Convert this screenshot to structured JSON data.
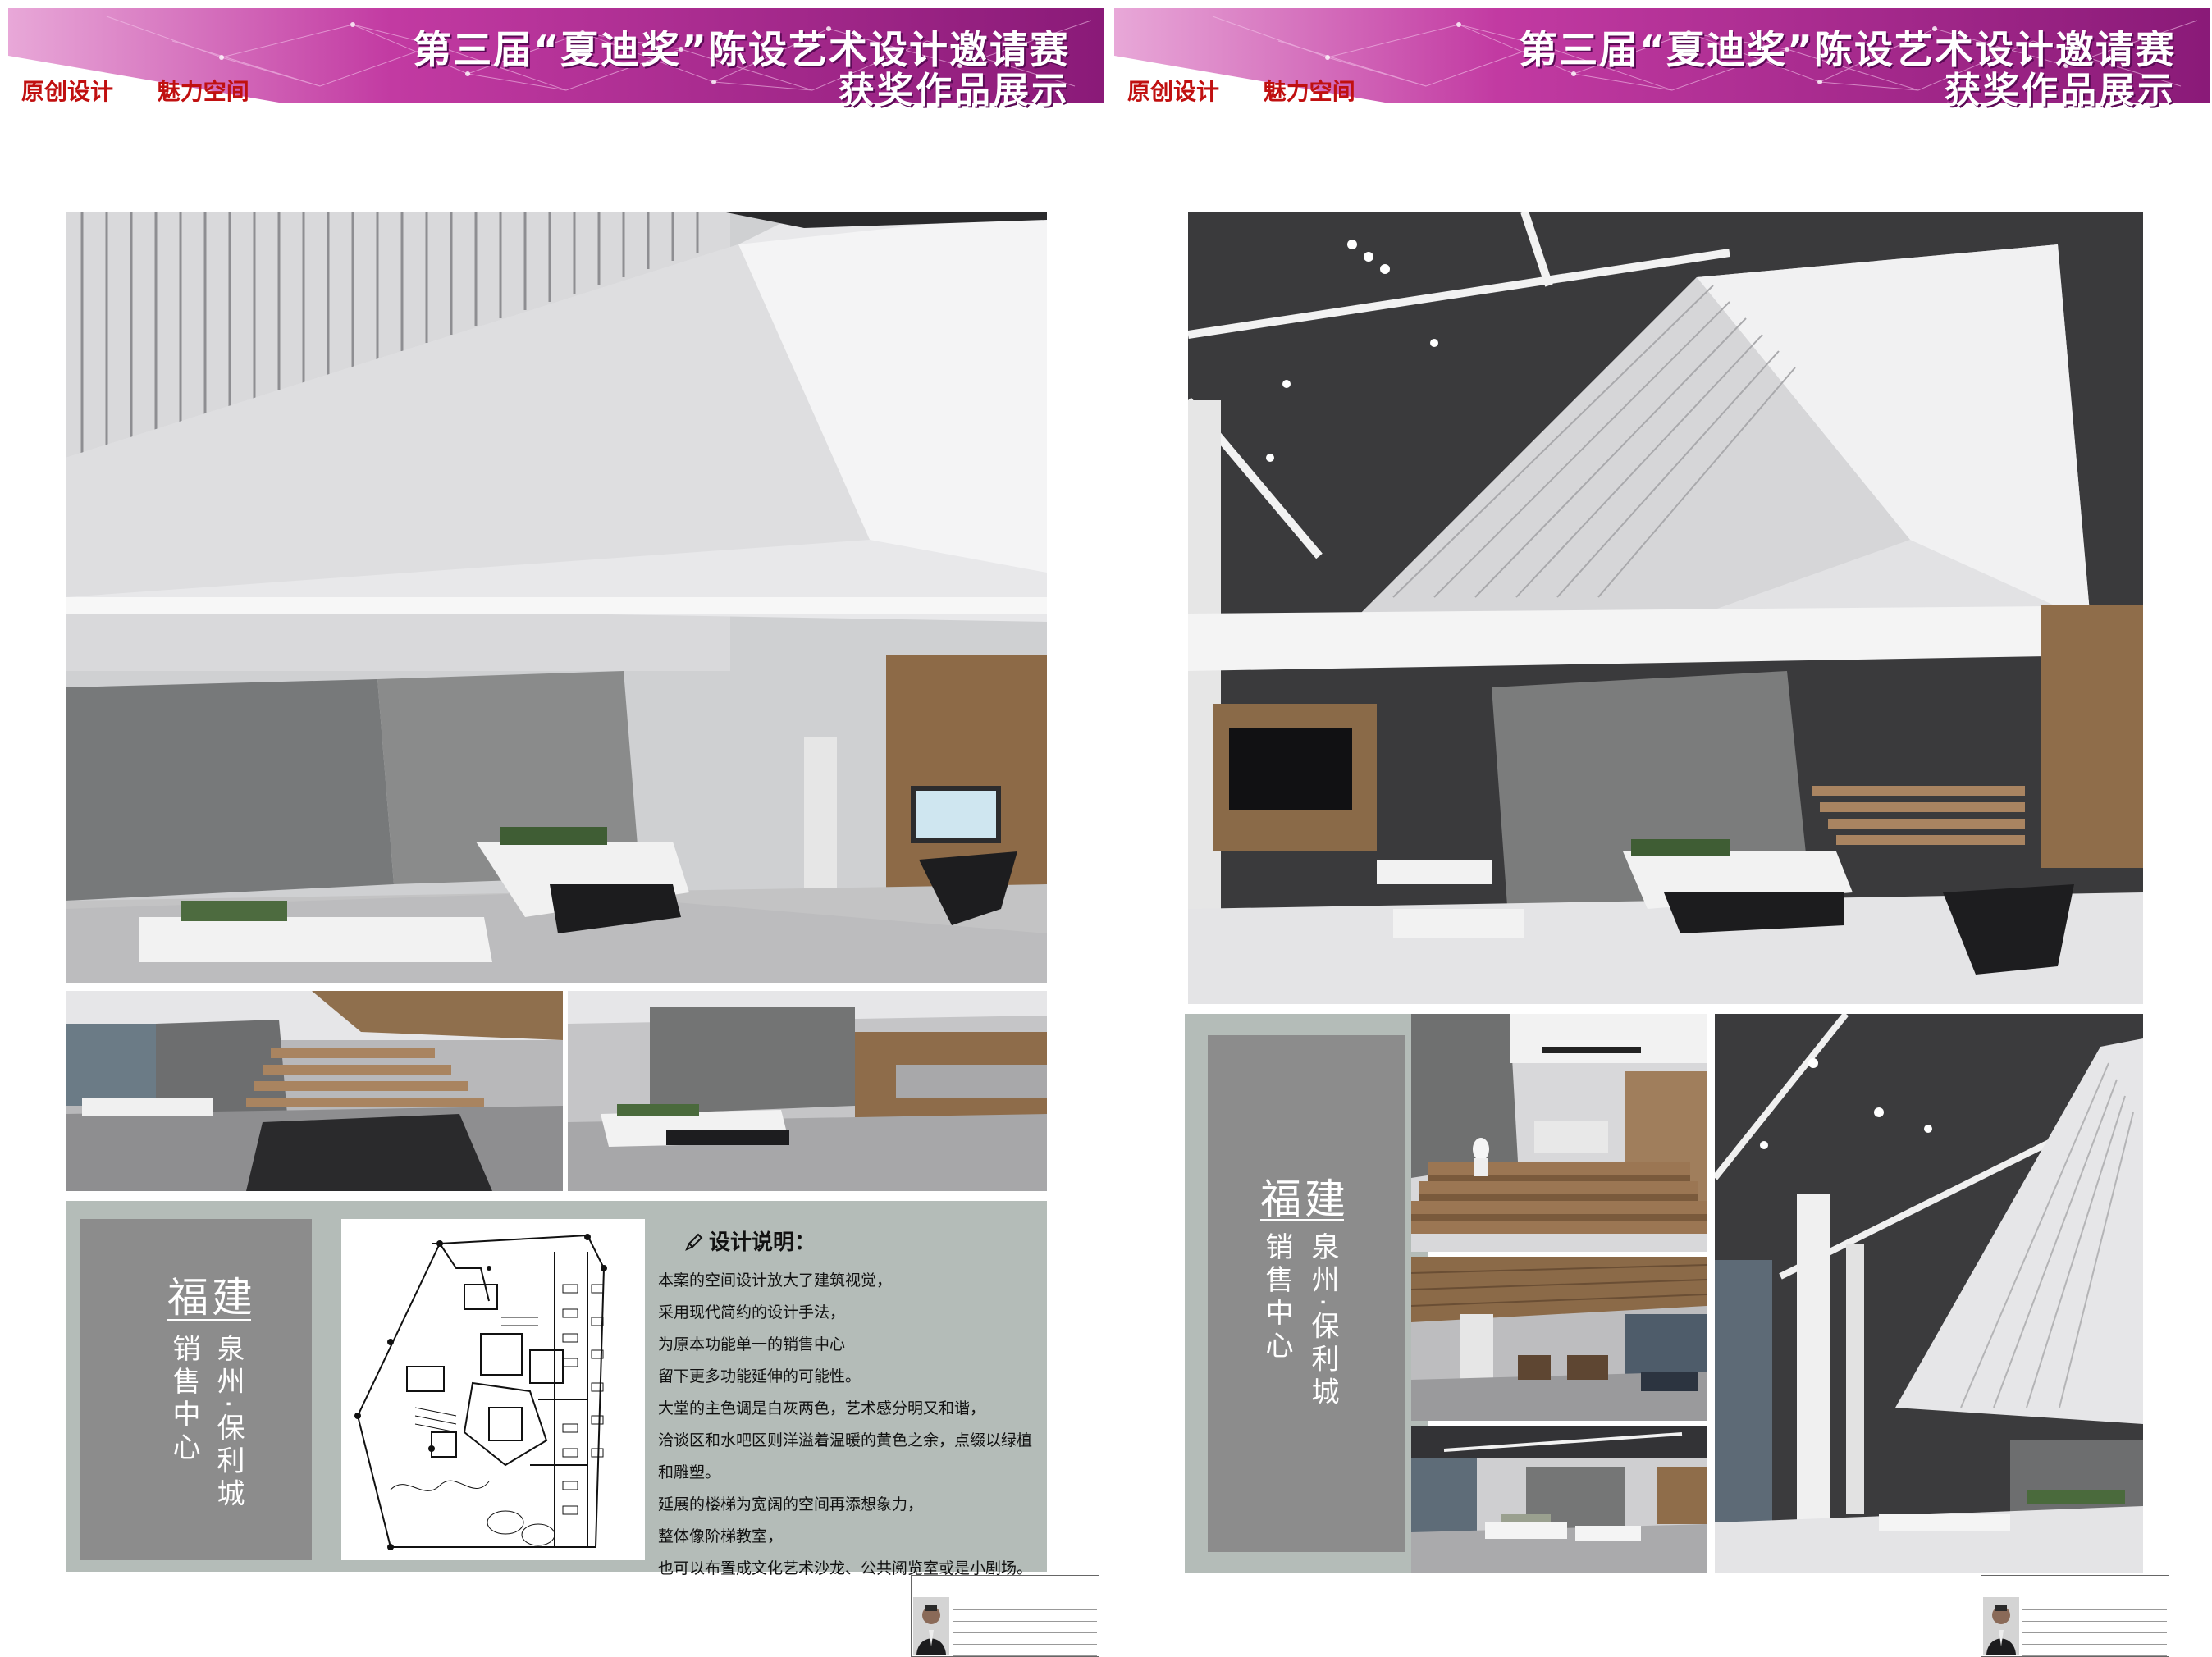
{
  "colors": {
    "banner_magenta": "#b0258f",
    "banner_pink": "#d955b8",
    "tagline_red": "#c01010",
    "panel_sage": "#b4bcb8",
    "title_box_gray": "#8c8c8c"
  },
  "header": {
    "title": "第三届“夏迪奖”陈设艺术设计邀请赛",
    "subtitle": "获奖作品展示",
    "tagline_1": "原创设计",
    "tagline_2": "魅力空间"
  },
  "project": {
    "region": "福建",
    "city_project": "泉州·保利城",
    "type": "销售中心"
  },
  "description": {
    "heading": "设计说明：",
    "lines": [
      "本案的空间设计放大了建筑视觉，",
      "采用现代简约的设计手法，",
      "为原本功能单一的销售中心",
      "留下更多功能延伸的可能性。",
      "大堂的主色调是白灰两色，艺术感分明又和谐，",
      "洽谈区和水吧区则洋溢着温暖的黄色之余，点缀以绿植",
      "和雕塑。",
      "延展的楼梯为宽阔的空间再添想象力，",
      "整体像阶梯教室，",
      "也可以布置成文化艺术沙龙、公共阅览室或是小剧场。"
    ]
  },
  "photos": {
    "left_main": "lobby-wide-view",
    "left_small_1": "staircase-view",
    "left_small_2": "reception-view",
    "right_main": "atrium-ceiling-view",
    "right_small_1": "seating-steps",
    "right_small_2": "lounge-area",
    "right_small_3": "model-display",
    "right_tall": "vertical-atrium"
  }
}
